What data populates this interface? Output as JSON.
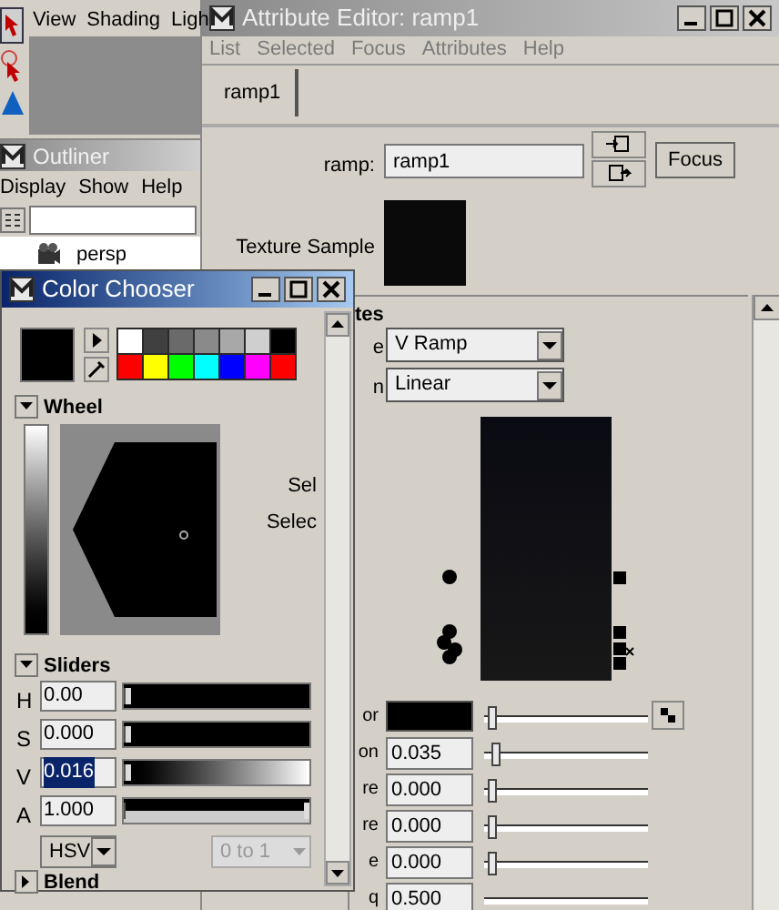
{
  "viewport_window": {
    "menu": [
      "View",
      "Shading",
      "Ligh"
    ]
  },
  "outliner": {
    "title": "Outliner",
    "menu": [
      "Display",
      "Show",
      "Help"
    ],
    "items": [
      {
        "label": "persp",
        "selected": false
      }
    ]
  },
  "attribute_editor": {
    "title": "Attribute Editor: ramp1",
    "menu": [
      "List",
      "Selected",
      "Focus",
      "Attributes",
      "Help"
    ],
    "tabs": [
      {
        "label": "ramp1",
        "selected": true
      }
    ],
    "node_label": "ramp:",
    "node_name": "ramp1",
    "focus_button": "Focus",
    "texture_sample_label": "Texture Sample",
    "section_title": "tes",
    "dropdowns": [
      {
        "label": "e",
        "value": "V Ramp"
      },
      {
        "label": "n",
        "value": "Linear"
      }
    ],
    "rows": [
      {
        "kind": "color",
        "label": "or",
        "level": 0.02
      },
      {
        "kind": "number",
        "label": "on",
        "value": "0.035",
        "level": 0.05
      },
      {
        "kind": "number",
        "label": "re",
        "value": "0.000",
        "level": 0.02
      },
      {
        "kind": "number",
        "label": "re",
        "value": "0.000",
        "level": 0.02
      },
      {
        "kind": "number",
        "label": "e",
        "value": "0.000",
        "level": 0.02
      },
      {
        "kind": "number",
        "label": "q",
        "value": "0.500"
      }
    ]
  },
  "color_chooser": {
    "title": "Color Chooser",
    "palette": [
      {
        "color": "#ffffff"
      },
      {
        "color": "#404040"
      },
      {
        "color": "#6a6a6a"
      },
      {
        "color": "#8a8a8a"
      },
      {
        "color": "#a8a8a8"
      },
      {
        "color": "#cfcfcf"
      },
      {
        "color": "#000000"
      },
      {
        "color": "#ff0000"
      },
      {
        "color": "#ffff00"
      },
      {
        "color": "#00ff00"
      },
      {
        "color": "#00ffff"
      },
      {
        "color": "#0000ff"
      },
      {
        "color": "#ff00ff"
      },
      {
        "color": "#ff0000"
      }
    ],
    "wheel_section": {
      "title": "Wheel",
      "expanded": true,
      "labels": [
        "Sel",
        "Selec"
      ]
    },
    "sliders_section": {
      "title": "Sliders",
      "expanded": true,
      "sliders": [
        {
          "label": "H",
          "value": "0.00",
          "level": 0,
          "kind": "solid",
          "selected": false
        },
        {
          "label": "S",
          "value": "0.000",
          "level": 0,
          "kind": "solid",
          "selected": false
        },
        {
          "label": "V",
          "value": "0.016",
          "level": 0.016,
          "kind": "gradient",
          "selected": true
        },
        {
          "label": "A",
          "value": "1.000",
          "level": 1,
          "kind": "split",
          "selected": false
        }
      ],
      "mode": "HSV",
      "range": "0 to 1"
    },
    "blend_section": {
      "title": "Blend",
      "expanded": false
    }
  }
}
